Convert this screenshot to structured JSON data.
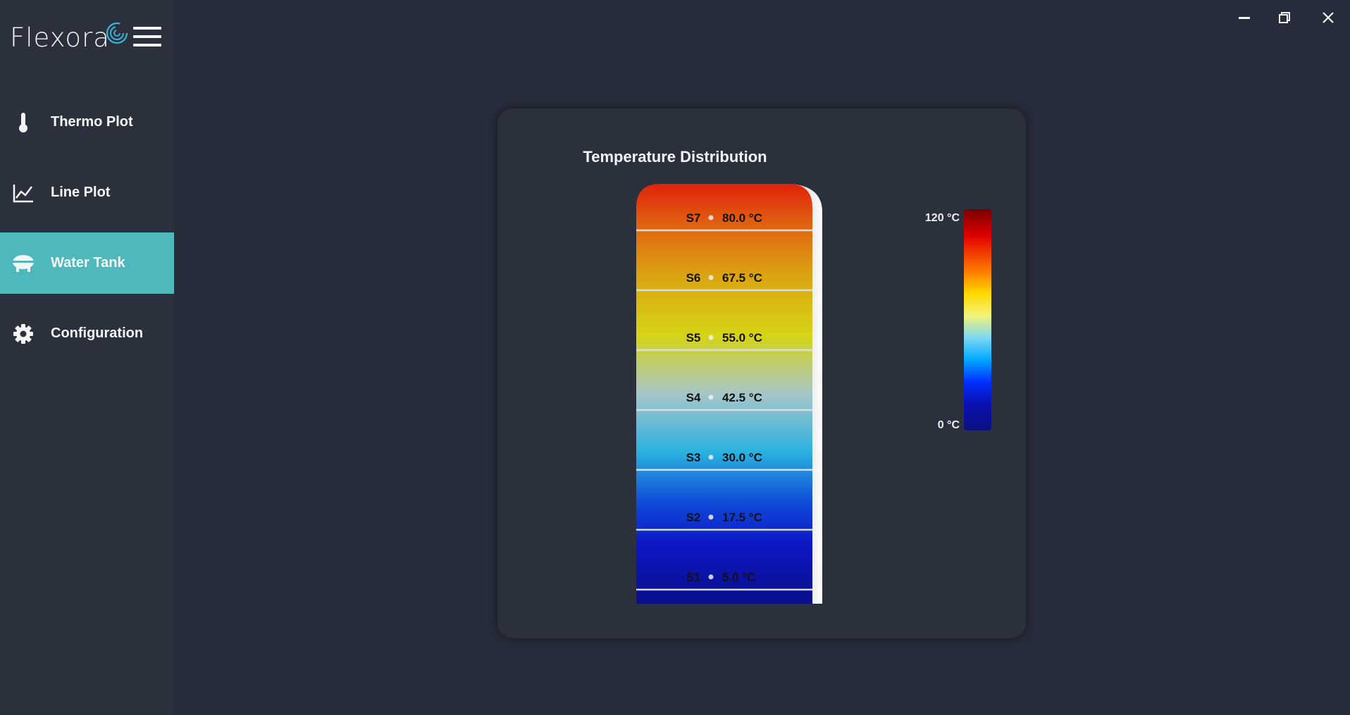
{
  "app": {
    "brand": "Flexora",
    "accent_color": "#4fb8bd"
  },
  "sidebar": {
    "items": [
      {
        "label": "Thermo Plot",
        "icon": "thermometer-icon",
        "active": false
      },
      {
        "label": "Line Plot",
        "icon": "line-chart-icon",
        "active": false
      },
      {
        "label": "Water Tank",
        "icon": "water-tank-icon",
        "active": true
      },
      {
        "label": "Configuration",
        "icon": "gear-icon",
        "active": false
      }
    ]
  },
  "window_controls": [
    "minimize-icon",
    "restore-icon",
    "close-icon"
  ],
  "chart_data": {
    "type": "heatmap",
    "title": "Temperature Distribution",
    "sensors": [
      {
        "name": "S7",
        "value": 80.0,
        "label": "80.0 °C"
      },
      {
        "name": "S6",
        "value": 67.5,
        "label": "67.5 °C"
      },
      {
        "name": "S5",
        "value": 55.0,
        "label": "55.0 °C"
      },
      {
        "name": "S4",
        "value": 42.5,
        "label": "42.5 °C"
      },
      {
        "name": "S3",
        "value": 30.0,
        "label": "30.0 °C"
      },
      {
        "name": "S2",
        "value": 17.5,
        "label": "17.5 °C"
      },
      {
        "name": "S1",
        "value": 5.0,
        "label": "5.0 °C"
      }
    ],
    "colorbar": {
      "min": 0,
      "max": 120,
      "min_label": "0 °C",
      "max_label": "120 °C",
      "colormap": "jet"
    }
  }
}
